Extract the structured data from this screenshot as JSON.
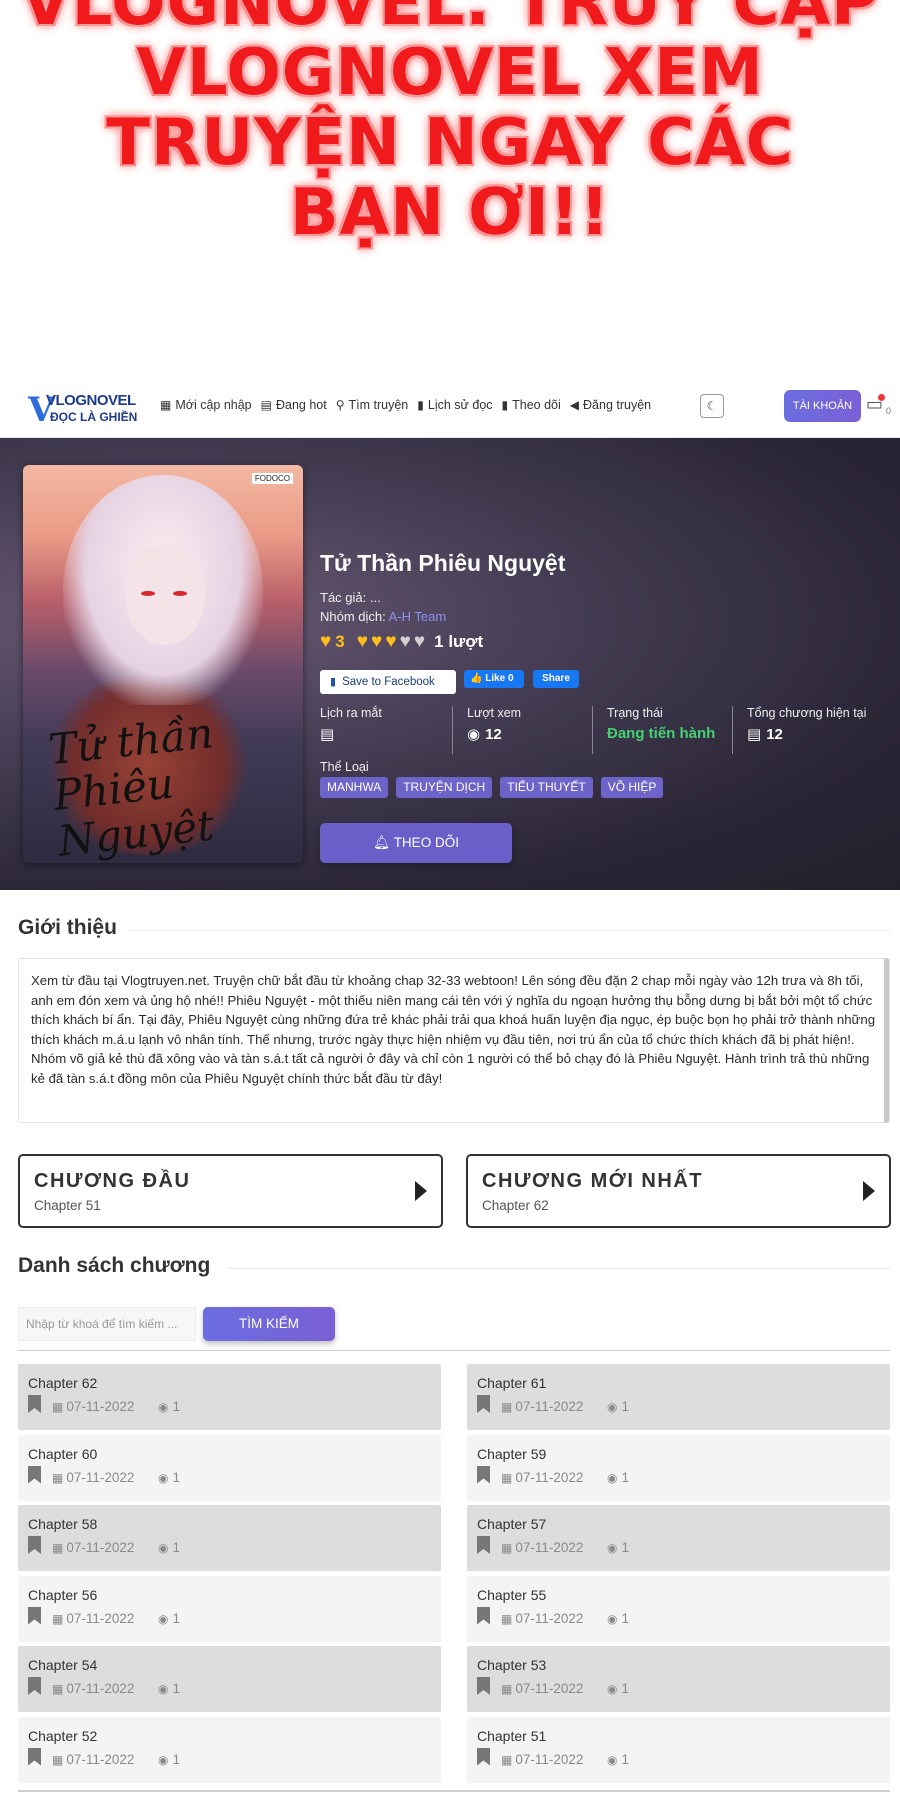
{
  "promo": {
    "lines": [
      "VLOGNOVEL. TRUY CẬP",
      "VLOGNOVEL XEM",
      "TRUYỆN NGAY CÁC",
      "BẠN ƠI!!"
    ]
  },
  "header": {
    "logo_top": "VLOGNOVEL",
    "logo_bottom": "ĐỌC LÀ GHIỀN",
    "nav": [
      {
        "icon": "grid-icon",
        "glyph": "▦",
        "label": "Mới cập nhập"
      },
      {
        "icon": "newspaper-icon",
        "glyph": "▤",
        "label": "Đang hot"
      },
      {
        "icon": "search-icon",
        "glyph": "⚲",
        "label": "Tìm truyện"
      },
      {
        "icon": "book-icon",
        "glyph": "▮",
        "label": "Lịch sử đọc"
      },
      {
        "icon": "bookmark-icon",
        "glyph": "▮",
        "label": "Theo dõi"
      },
      {
        "icon": "megaphone-icon",
        "glyph": "◀",
        "label": "Đăng truyện"
      }
    ],
    "theme_toggle": "☾",
    "account_label": "TÀI KHOẢN",
    "chat_count": "0"
  },
  "manga": {
    "title": "Tử Thần Phiêu Nguyệt",
    "cover_text": "Tử thần Phiêu Nguyệt",
    "cover_publisher": "FODOCO",
    "author_label": "Tác giả:",
    "author_value": "...",
    "group_label": "Nhóm dịch:",
    "group_value": "A-H Team",
    "rating_value": "3",
    "hearts_filled": 3,
    "hearts_total": 5,
    "rating_count": "1 lượt",
    "fb_save_label": "Save to Facebook",
    "fb_like_label": "Like 0",
    "fb_share_label": "Share",
    "stats": {
      "release_label": "Lịch ra mắt",
      "release_icon": "newspaper-icon",
      "views_label": "Lượt xem",
      "views_value": "12",
      "status_label": "Trạng thái",
      "status_value": "Đang tiến hành",
      "total_label": "Tổng chương hiện tại",
      "total_value": "12"
    },
    "genres_label": "Thể Loại",
    "genres": [
      "MANHWA",
      "TRUYỆN DỊCH",
      "TIỂU THUYẾT",
      "VÕ HIỆP"
    ],
    "follow_label": "THEO DÕI",
    "colors": {
      "accent": "#6a5fc9",
      "status_green": "#44d171",
      "heart_gold": "#ffbe1a"
    }
  },
  "intro": {
    "title": "Giới thiệu",
    "text": "Xem từ đầu tại Vlogtruyen.net. Truyện chữ bắt đầu từ khoảng chap 32-33 webtoon! Lên sóng đều đặn 2 chap mỗi ngày vào 12h trưa và 8h tối, anh em đón xem và ủng hộ nhé!! Phiêu Nguyệt - một thiếu niên mang cái tên với ý nghĩa du ngoạn hưởng thụ bỗng dưng bị bắt bởi một tổ chức thích khách bí ẩn. Tại đây, Phiêu Nguyệt cùng những đứa trẻ khác phải trải qua khoá huấn luyện địa ngục, ép buộc bọn họ phải trở thành những thích khách m.á.u lạnh vô nhân tính. Thế nhưng, trước ngày thực hiện nhiệm vụ đầu tiên, nơi trú ẩn của tổ chức thích khách đã bị phát hiện!. Nhóm võ giả kẻ thù đã xông vào và tàn s.á.t tất cả người ở đây và chỉ còn 1 người có thể bỏ chạy đó là Phiêu Nguyệt. Hành trình trả thù những kẻ đã tàn s.á.t đồng môn của Phiêu Nguyệt chính thức bắt đầu từ đây!"
  },
  "quick": {
    "first_title": "CHƯƠNG ĐẦU",
    "first_chapter": "Chapter 51",
    "latest_title": "CHƯƠNG MỚI NHẤT",
    "latest_chapter": "Chapter 62"
  },
  "chapters_section": {
    "title": "Danh sách chương",
    "search_placeholder": "Nhập từ khoá để tìm kiếm ...",
    "search_button": "TÌM KIẾM",
    "items": [
      {
        "name": "Chapter 62",
        "date": "07-11-2022",
        "views": "1"
      },
      {
        "name": "Chapter 61",
        "date": "07-11-2022",
        "views": "1"
      },
      {
        "name": "Chapter 60",
        "date": "07-11-2022",
        "views": "1"
      },
      {
        "name": "Chapter 59",
        "date": "07-11-2022",
        "views": "1"
      },
      {
        "name": "Chapter 58",
        "date": "07-11-2022",
        "views": "1"
      },
      {
        "name": "Chapter 57",
        "date": "07-11-2022",
        "views": "1"
      },
      {
        "name": "Chapter 56",
        "date": "07-11-2022",
        "views": "1"
      },
      {
        "name": "Chapter 55",
        "date": "07-11-2022",
        "views": "1"
      },
      {
        "name": "Chapter 54",
        "date": "07-11-2022",
        "views": "1"
      },
      {
        "name": "Chapter 53",
        "date": "07-11-2022",
        "views": "1"
      },
      {
        "name": "Chapter 52",
        "date": "07-11-2022",
        "views": "1"
      },
      {
        "name": "Chapter 51",
        "date": "07-11-2022",
        "views": "1"
      }
    ]
  }
}
